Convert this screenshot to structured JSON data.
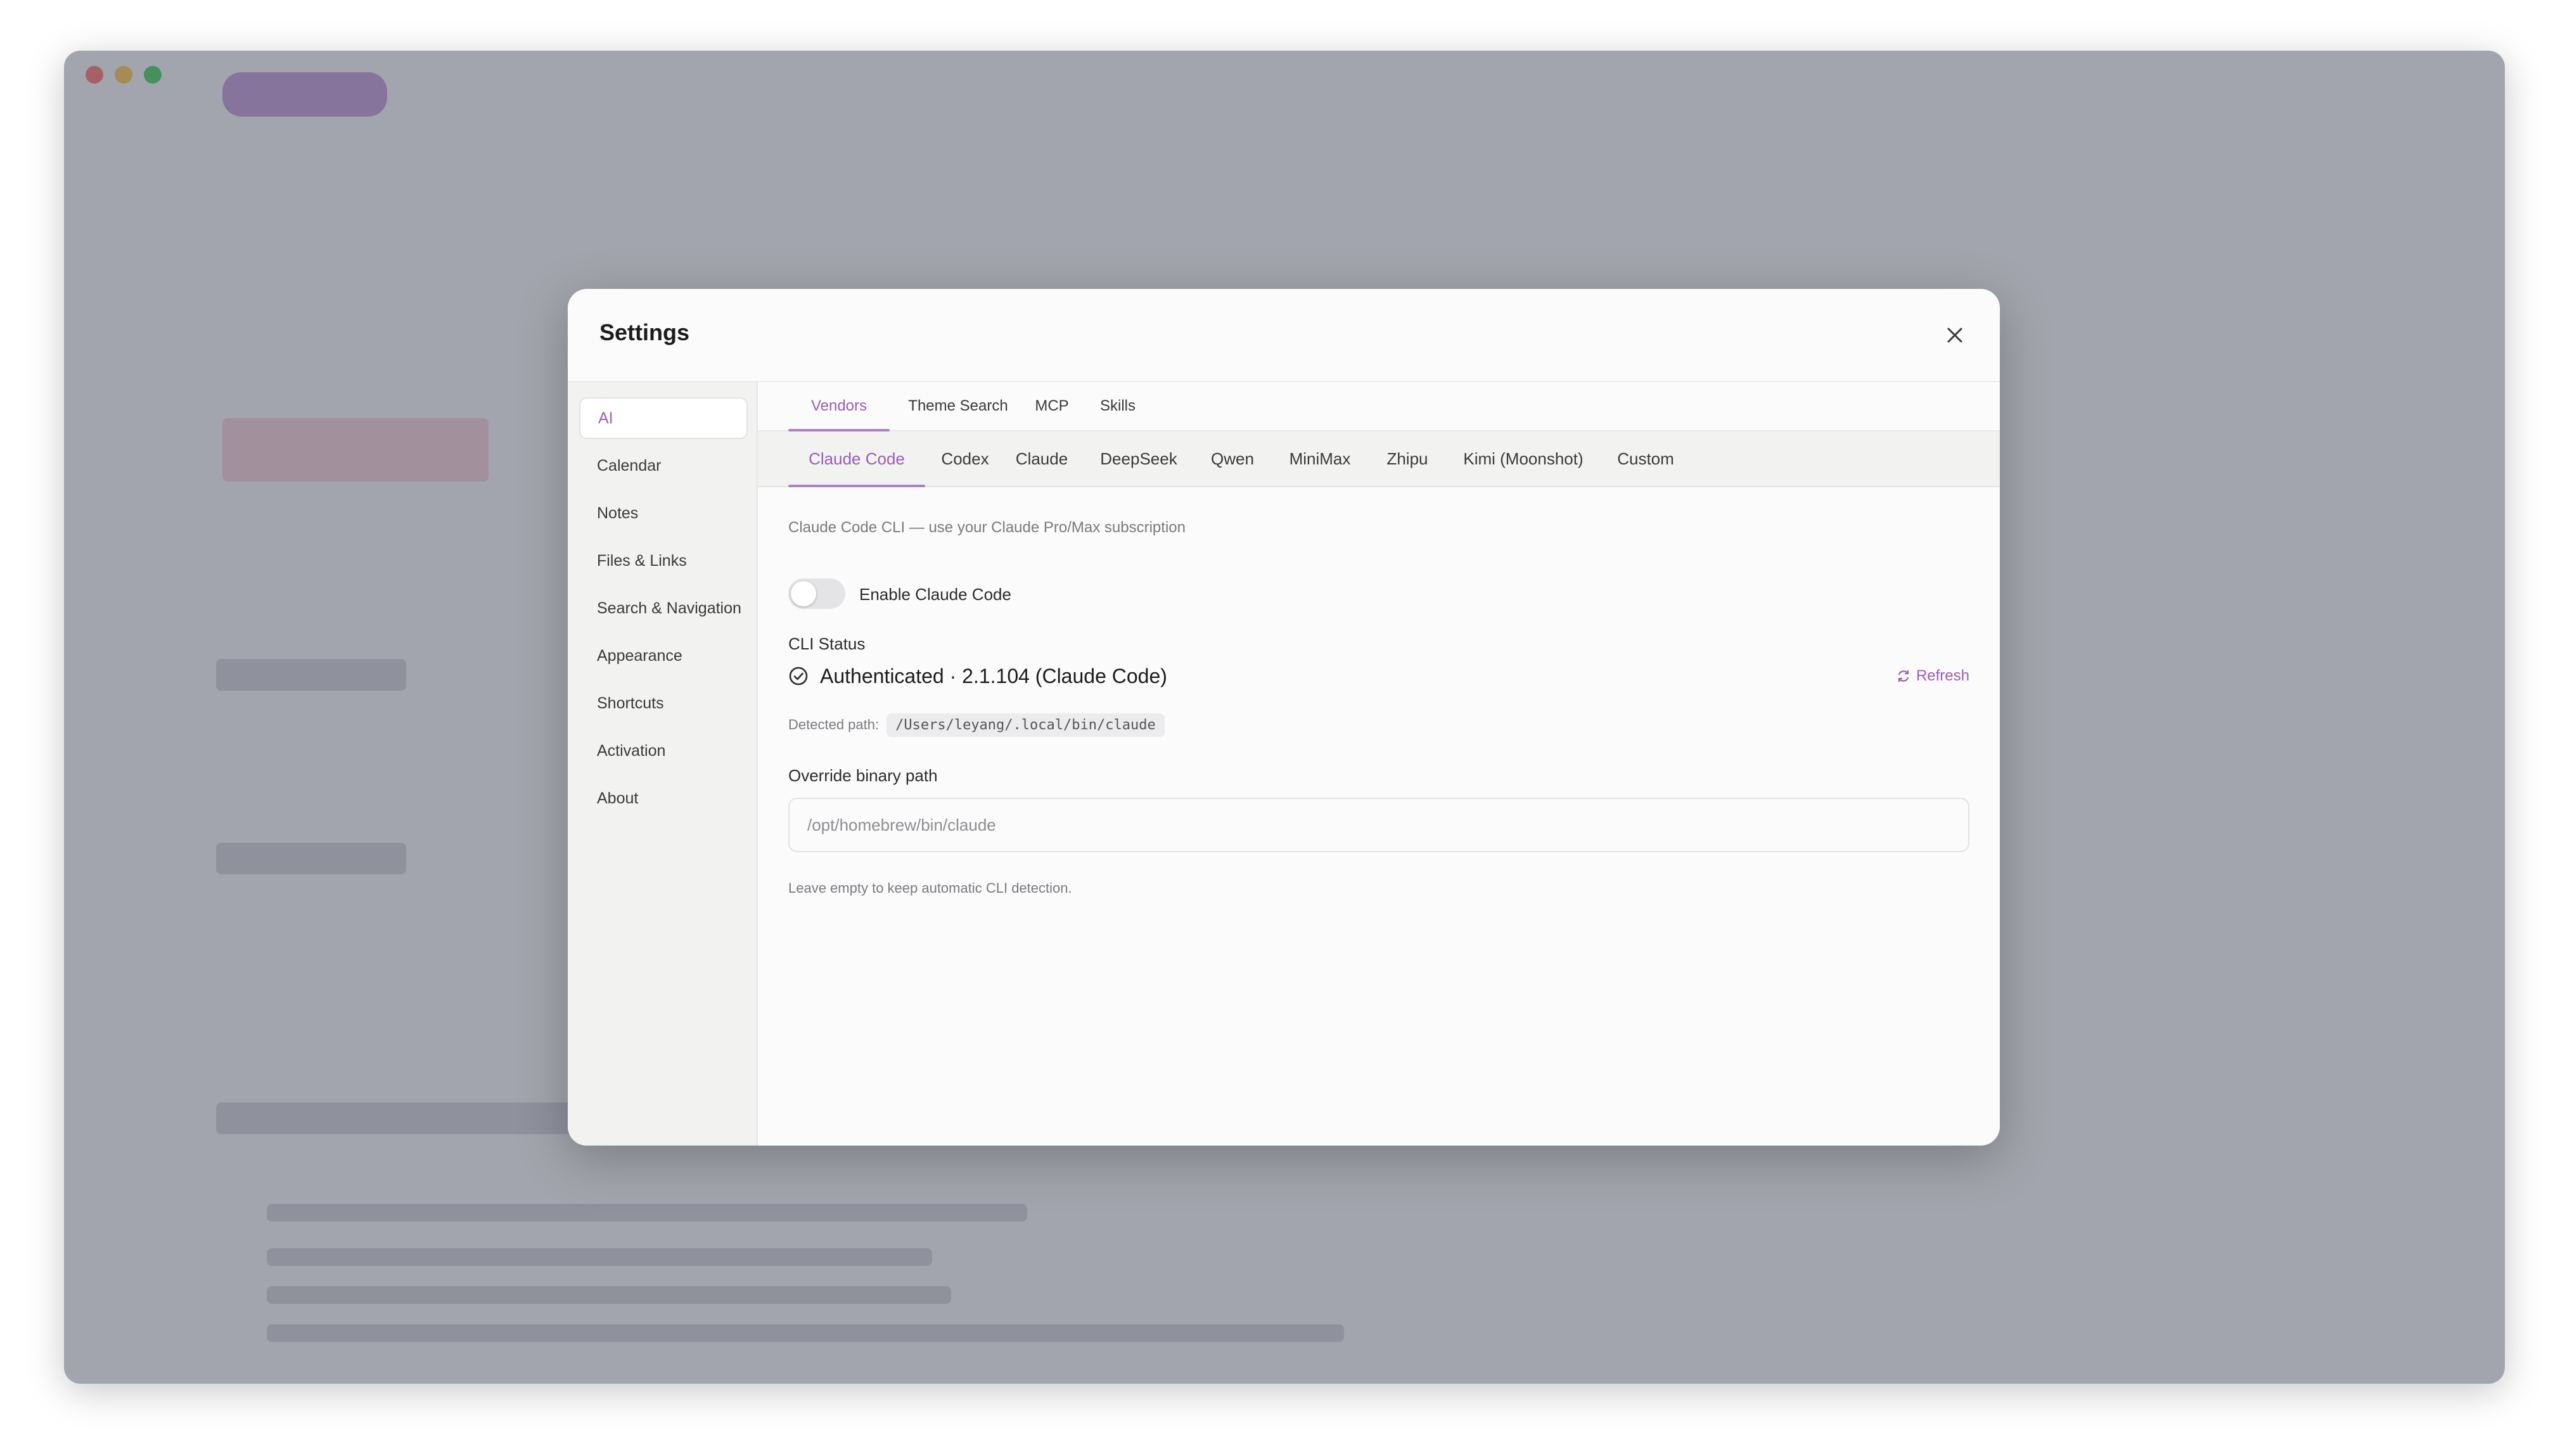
{
  "dialog": {
    "title": "Settings"
  },
  "sidebar": {
    "items": [
      {
        "label": "AI",
        "active": true
      },
      {
        "label": "Calendar"
      },
      {
        "label": "Notes"
      },
      {
        "label": "Files & Links"
      },
      {
        "label": "Search & Navigation"
      },
      {
        "label": "Appearance"
      },
      {
        "label": "Shortcuts"
      },
      {
        "label": "Activation"
      },
      {
        "label": "About"
      }
    ]
  },
  "top_tabs": [
    {
      "label": "Vendors",
      "active": true
    },
    {
      "label": "Theme Search"
    },
    {
      "label": "MCP"
    },
    {
      "label": "Skills"
    }
  ],
  "vendor_tabs": [
    {
      "label": "Claude Code",
      "active": true
    },
    {
      "label": "Codex"
    },
    {
      "label": "Claude"
    },
    {
      "label": "DeepSeek"
    },
    {
      "label": "Qwen"
    },
    {
      "label": "MiniMax"
    },
    {
      "label": "Zhipu"
    },
    {
      "label": "Kimi (Moonshot)"
    },
    {
      "label": "Custom"
    }
  ],
  "claude_code": {
    "description": "Claude Code CLI — use your Claude Pro/Max subscription",
    "enable_label": "Enable Claude Code",
    "enabled": false,
    "cli_status_label": "CLI Status",
    "status_text": "Authenticated · 2.1.104 (Claude Code)",
    "refresh_label": "Refresh",
    "detected_path_label": "Detected path:",
    "detected_path": "/Users/leyang/.local/bin/claude",
    "override_label": "Override binary path",
    "override_value": "",
    "override_placeholder": "/opt/homebrew/bin/claude",
    "hint": "Leave empty to keep automatic CLI detection."
  },
  "colors": {
    "accent": "#9a5fb5",
    "accent_underline": "#b07fc6",
    "overlay": "#5f6272"
  }
}
